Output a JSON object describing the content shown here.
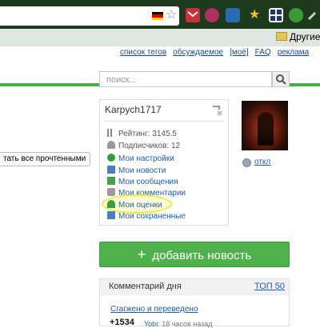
{
  "browser": {
    "bookmark_folder": "Другие"
  },
  "nav": {
    "links": [
      "список тегов",
      "обсуждаемое",
      "[моё]",
      "FAQ",
      "реклама"
    ]
  },
  "search": {
    "placeholder": "поиск..."
  },
  "mark_read_button": "тать все прочтенными",
  "user": {
    "name": "Karpych1717",
    "rating": "Рейтинг: 3145.5",
    "subscribers": "Подписчиков: 12",
    "menu": [
      {
        "label": "Мои настройки",
        "icon": "gear-icon",
        "color": "#3a9a3a"
      },
      {
        "label": "Мои новости",
        "icon": "news-icon",
        "color": "#4a7fc0"
      },
      {
        "label": "Мои сообщения",
        "icon": "mail-icon",
        "color": "#4aa04a"
      },
      {
        "label": "Мои комментарии",
        "icon": "comment-icon",
        "color": "#9a9a9a"
      },
      {
        "label": "Мои оценки",
        "icon": "rating-icon",
        "color": "#3aa03a"
      },
      {
        "label": "Мои сохраненные",
        "icon": "save-icon",
        "color": "#4a7fc0"
      }
    ]
  },
  "avatar": {
    "off_label": "откл"
  },
  "add_news": {
    "label": "добавить новость"
  },
  "comment_of_day": {
    "title": "Комментарий дня",
    "top_label": "ТОП 50",
    "link": "Сгагжено и переведено",
    "score": "+1534",
    "user": "Yobi",
    "time": ": 18 часов назад"
  },
  "colors": {
    "accent_green": "#4aad45",
    "link_blue": "#1a5fb4",
    "highlight_yellow": "#f1ea3a"
  }
}
